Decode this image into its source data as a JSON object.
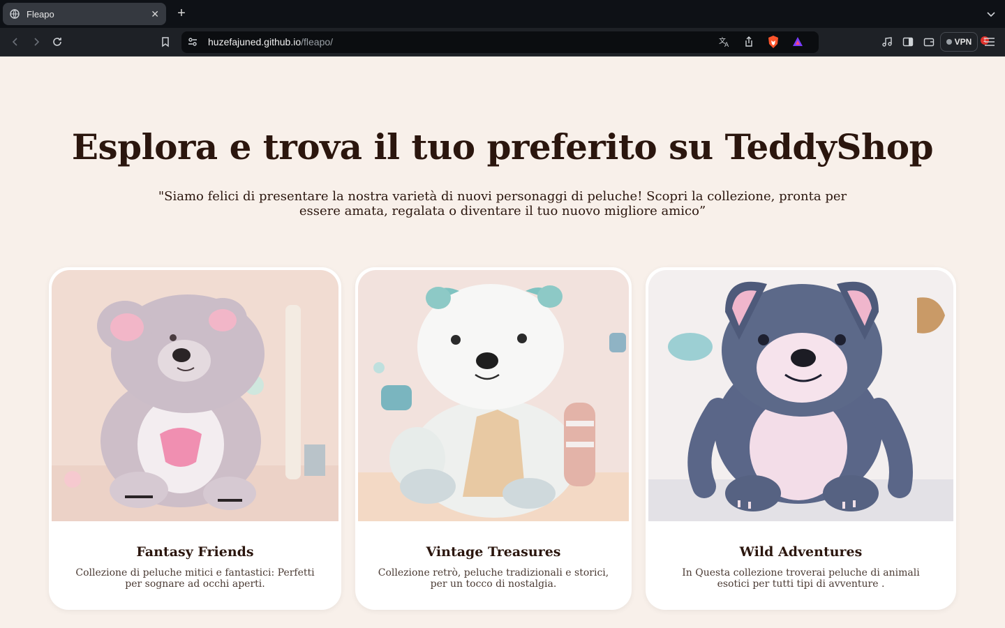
{
  "browser": {
    "tab_title": "Fleapo",
    "url_host": "huzefajuned.github.io",
    "url_path": "/fleapo/",
    "vpn_label": "VPN",
    "notification_count": "1"
  },
  "hero": {
    "title": "Esplora e trova il tuo preferito su TeddyShop",
    "subtitle": "\"Siamo felici di presentare la nostra varietà di nuovi personaggi di peluche! Scopri la collezione, pronta per essere amata, regalata o diventare il tuo nuovo migliore amico”"
  },
  "cards": [
    {
      "title": "Fantasy Friends",
      "description": "Collezione di peluche mitici e fantastici: Perfetti per sognare ad occhi aperti.",
      "image": "grey-pink-teddy-bear"
    },
    {
      "title": "Vintage Treasures",
      "description": "Collezione retrò, peluche tradizionali e storici, per un tocco di nostalgia.",
      "image": "white-pastel-teddy-bear"
    },
    {
      "title": "Wild Adventures",
      "description": "In Questa collezione troverai peluche di animali esotici per tutti tipi di avventure .",
      "image": "navy-blue-puppy-plush"
    }
  ]
}
